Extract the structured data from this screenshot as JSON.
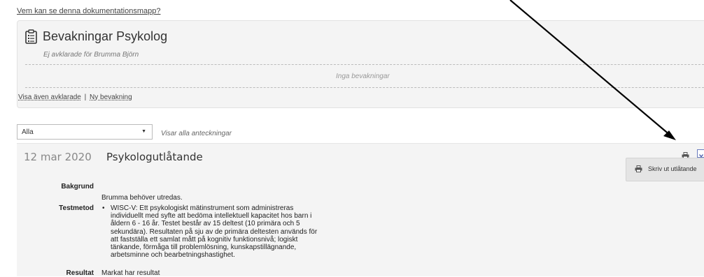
{
  "top_link": "Vem kan se denna dokumentationsmapp?",
  "panel": {
    "title": "Bevakningar Psykolog",
    "subtitle": "Ej avklarade för Brumma Björn",
    "empty_text": "Inga bevakningar",
    "show_resolved": "Visa även avklarade",
    "separator": "|",
    "new_watch": "Ny bevakning"
  },
  "filter": {
    "selected": "Alla",
    "info": "Visar alla anteckningar"
  },
  "entry": {
    "date": "12 mar 2020",
    "title": "Psykologutlåtande",
    "print_menu_item": "Skriv ut utlåtande",
    "fields": {
      "background_label": "Bakgrund",
      "background_text": "Brumma behöver utredas.",
      "method_label": "Testmetod",
      "method_text": "WISC-V: Ett psykologiskt mätinstrument som administreras individuellt med syfte att bedöma intellektuell kapacitet hos barn i åldern 6 - 16 år. Testet består av 15 deltest (10 primära och 5 sekundära). Resultaten på sju av de primära deltesten används för att fastställa ett samlat mått på kognitiv funktionsnivå; logiskt tänkande, förmåga till problemlösning, kunskapstillägnande, arbetsminne och bearbetningshastighet.",
      "result_label": "Resultat",
      "result_text": "Markat har resultat"
    }
  },
  "colors": {
    "panel_bg": "#f4f4f4",
    "toggle_border": "#6a7bbd"
  }
}
